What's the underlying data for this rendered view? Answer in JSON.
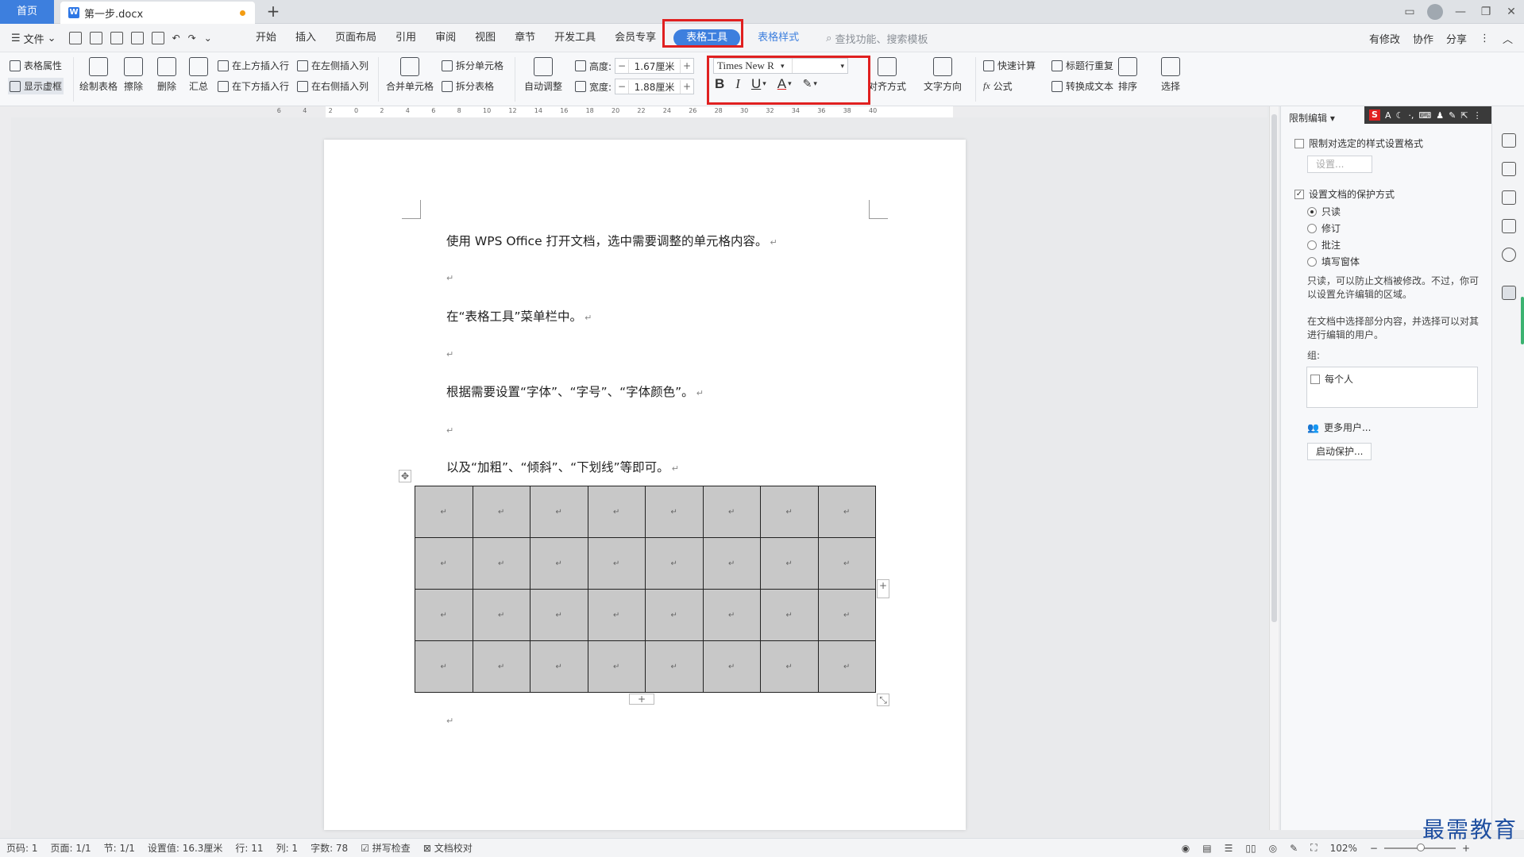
{
  "tabs": {
    "home": "首页",
    "document": "第一步.docx"
  },
  "menu": {
    "file": "文件",
    "tabs": [
      "开始",
      "插入",
      "页面布局",
      "引用",
      "审阅",
      "视图",
      "章节",
      "开发工具",
      "会员专享"
    ],
    "active_tab": "表格工具",
    "blue_tab": "表格样式",
    "search_placeholder": "查找功能、搜索模板",
    "right": {
      "changes": "有修改",
      "collab": "协作",
      "share": "分享"
    }
  },
  "ribbon": {
    "table_props": "表格属性",
    "show_gridlines": "显示虚框",
    "draw_table": "绘制表格",
    "erase": "擦除",
    "delete": "删除",
    "summary": "汇总",
    "insert_above": "在上方插入行",
    "insert_below": "在下方插入行",
    "insert_left": "在左侧插入列",
    "insert_right": "在右侧插入列",
    "merge_cells": "合并单元格",
    "split_cells": "拆分单元格",
    "split_table": "拆分表格",
    "auto_fit": "自动调整",
    "height_label": "高度:",
    "height_value": "1.67厘米",
    "width_label": "宽度:",
    "width_value": "1.88厘米",
    "font_name": "Times New R",
    "bold": "B",
    "italic": "I",
    "underline": "U",
    "font_color": "A",
    "align": "对齐方式",
    "text_direction": "文字方向",
    "quick_calc": "快速计算",
    "formula": "公式",
    "repeat_header": "标题行重复",
    "to_text": "转换成文本",
    "sort": "排序",
    "select": "选择"
  },
  "document": {
    "paragraphs": [
      "使用 WPS Office 打开文档，选中需要调整的单元格内容。",
      "在“表格工具”菜单栏中。",
      "根据需要设置“字体”、“字号”、“字体颜色”。",
      "以及“加粗”、“倾斜”、“下划线”等即可。"
    ],
    "table": {
      "rows": 4,
      "cols": 8
    }
  },
  "rightpane": {
    "title": "限制编辑",
    "limit_format": "限制对选定的样式设置格式",
    "settings_btn": "设置...",
    "protect_mode": "设置文档的保护方式",
    "options": [
      "只读",
      "修订",
      "批注",
      "填写窗体"
    ],
    "readonly_desc": "只读，可以防止文档被修改。不过，你可以设置允许编辑的区域。",
    "select_desc": "在文档中选择部分内容，并选择可以对其进行编辑的用户。",
    "group_label": "组:",
    "everyone": "每个人",
    "more_users": "更多用户...",
    "start_protect": "启动保护..."
  },
  "status": {
    "page_num": "页码: 1",
    "pages": "页面: 1/1",
    "section": "节: 1/1",
    "setting": "设置值: 16.3厘米",
    "row": "行: 11",
    "col": "列: 1",
    "words": "字数: 78",
    "spellcheck": "拼写检查",
    "proofread": "文档校对",
    "zoom": "102%"
  },
  "watermark": "最需教育",
  "colors": {
    "accent": "#3d7fde",
    "highlight": "#e02020",
    "cell_fill": "#c8c8c8"
  }
}
